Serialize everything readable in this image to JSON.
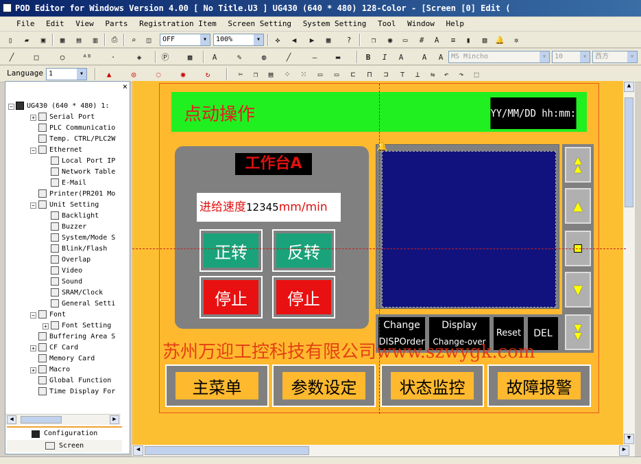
{
  "window": {
    "title": "POD Editor for Windows Version 4.00 [ No Title.U3 ] UG430 (640 * 480) 128-Color - [Screen [0] Edit ("
  },
  "menu": [
    "File",
    "Edit",
    "View",
    "Parts",
    "Registration Item",
    "Screen Setting",
    "System Setting",
    "Tool",
    "Window",
    "Help"
  ],
  "toolbar": {
    "state_select": "OFF",
    "zoom_select": "100%",
    "language_label": "Language",
    "language_value": "1",
    "font_name": "MS Mincho",
    "font_size": "10",
    "font_lang": "西方"
  },
  "tree": {
    "root": "UG430 (640 * 480) 1:",
    "items": [
      "Serial Port",
      "PLC Communicatio",
      "Temp. CTRL/PLC2W",
      "Ethernet",
      "Local Port IP",
      "Network Table",
      "E-Mail",
      "Printer(PR201 Mo",
      "Unit Setting",
      "Backlight",
      "Buzzer",
      "System/Mode S",
      "Blink/Flash",
      "Overlap",
      "Video",
      "Sound",
      "SRAM/Clock",
      "General Setti",
      "Font",
      "Font Setting",
      "Buffering Area S",
      "CF Card",
      "Memory Card",
      "Macro",
      "Global Function",
      "Time Display For"
    ]
  },
  "panel_tabs": {
    "configuration": "Configuration",
    "screen": "Screen"
  },
  "hmi": {
    "title": "点动操作",
    "datetime": "YY/MM/DD hh:mm:ss",
    "station": "工作台A",
    "feed_label": "进给速度",
    "feed_value": "12345",
    "feed_unit": "mm/min",
    "forward": "正转",
    "reverse": "反转",
    "stop1": "停止",
    "stop2": "停止",
    "alarm_change": "Change",
    "alarm_display": "Display",
    "alarm_reset": "Reset",
    "alarm_del": "DEL",
    "alarm_disporder": "DISPOrder",
    "alarm_changeover": "Change-over",
    "watermark": "苏州万迎工控科技有限公司www.szwygk.com",
    "nav_main": "主菜单",
    "nav_params": "参数设定",
    "nav_status": "状态监控",
    "nav_alarm": "故障报警"
  },
  "colors": {
    "canvas": "#fdbf32",
    "header": "#20f020",
    "display": "#12127e",
    "green_btn": "#1aa37a",
    "red_btn": "#e81010"
  }
}
